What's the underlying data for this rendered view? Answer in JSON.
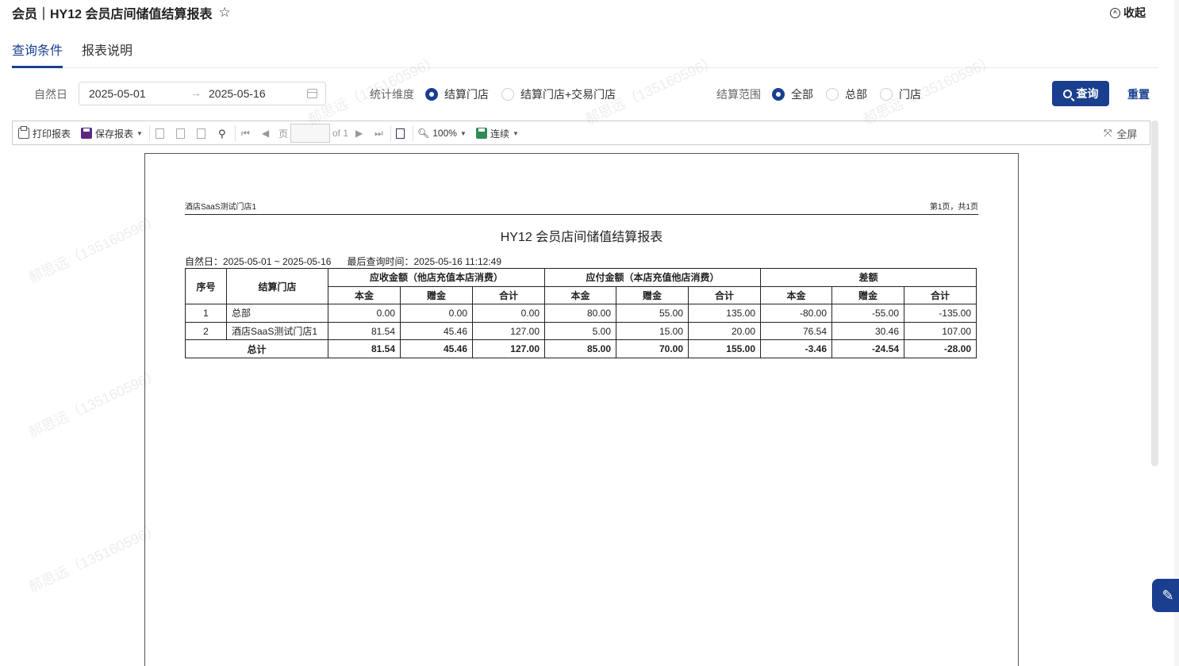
{
  "header": {
    "title": "会员｜HY12 会员店间储值结算报表",
    "star": "☆",
    "collapse_label": "收起"
  },
  "tabs": [
    {
      "label": "查询条件",
      "active": true
    },
    {
      "label": "报表说明",
      "active": false
    }
  ],
  "filters": {
    "date_label": "自然日",
    "date_start": "2025-05-01",
    "date_end": "2025-05-16",
    "dimension_label": "统计维度",
    "dimension_options": [
      {
        "label": "结算门店",
        "checked": true
      },
      {
        "label": "结算门店+交易门店",
        "checked": false
      }
    ],
    "scope_label": "结算范围",
    "scope_options": [
      {
        "label": "全部",
        "checked": true
      },
      {
        "label": "总部",
        "checked": false
      },
      {
        "label": "门店",
        "checked": false
      }
    ],
    "query_button": "查询",
    "reset_button": "重置"
  },
  "toolbar": {
    "print": "打印报表",
    "save": "保存报表",
    "page_label": "页",
    "page_of": "of 1",
    "zoom": "100%",
    "mode": "连续",
    "fullscreen": "全屏"
  },
  "report": {
    "store_name": "酒店SaaS测试门店1",
    "page_info": "第1页，共1页",
    "title": "HY12 会员店间储值结算报表",
    "meta_date": "自然日：2025-05-01 ~ 2025-05-16",
    "meta_time": "最后查询时间：2025-05-16 11:12:49",
    "headers": {
      "seq": "序号",
      "store": "结算门店",
      "receivable": "应收金额（他店充值本店消费）",
      "payable": "应付金额（本店充值他店消费）",
      "diff": "差额",
      "principal": "本金",
      "gift": "赠金",
      "total": "合计"
    },
    "rows": [
      {
        "seq": "1",
        "store": "总部",
        "values": [
          "0.00",
          "0.00",
          "0.00",
          "80.00",
          "55.00",
          "135.00",
          "-80.00",
          "-55.00",
          "-135.00"
        ]
      },
      {
        "seq": "2",
        "store": "酒店SaaS测试门店1",
        "values": [
          "81.54",
          "45.46",
          "127.00",
          "5.00",
          "15.00",
          "20.00",
          "76.54",
          "30.46",
          "107.00"
        ]
      }
    ],
    "total_row": {
      "label": "总计",
      "values": [
        "81.54",
        "45.46",
        "127.00",
        "85.00",
        "70.00",
        "155.00",
        "-3.46",
        "-24.54",
        "-28.00"
      ]
    }
  },
  "watermark": "郝思远（13516059​6）"
}
